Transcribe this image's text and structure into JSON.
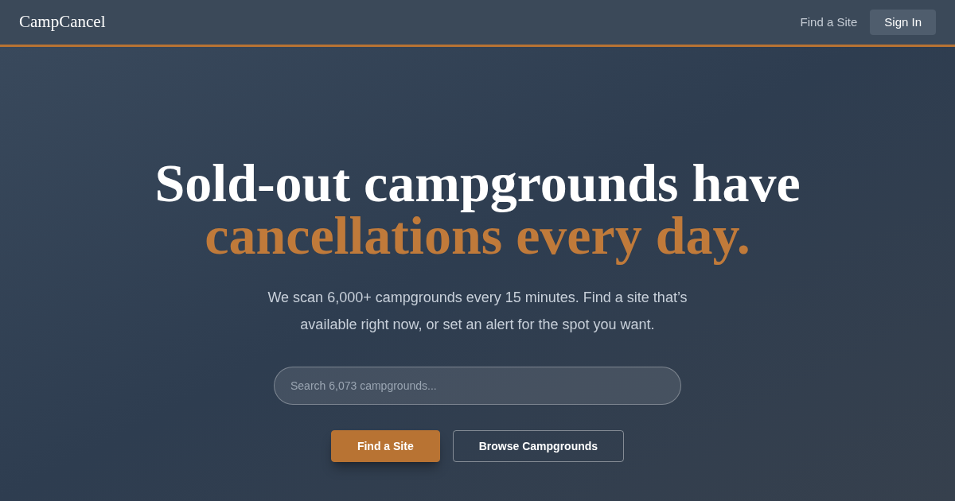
{
  "header": {
    "logo": "CampCancel",
    "nav_link": "Find a Site",
    "sign_in": "Sign In"
  },
  "hero": {
    "headline": "Sold-out campgrounds have",
    "headline_accent": "cancellations every day.",
    "subtitle": "We scan 6,000+ campgrounds every 15 minutes. Find a site that’s available right now, or set an alert for the spot you want.",
    "search": {
      "placeholder": "Search 6,073 campgrounds..."
    },
    "buttons": [
      {
        "label": "Find a Site",
        "kind": "primary"
      },
      {
        "label": "Browse Campgrounds",
        "kind": "outline"
      }
    ]
  }
}
